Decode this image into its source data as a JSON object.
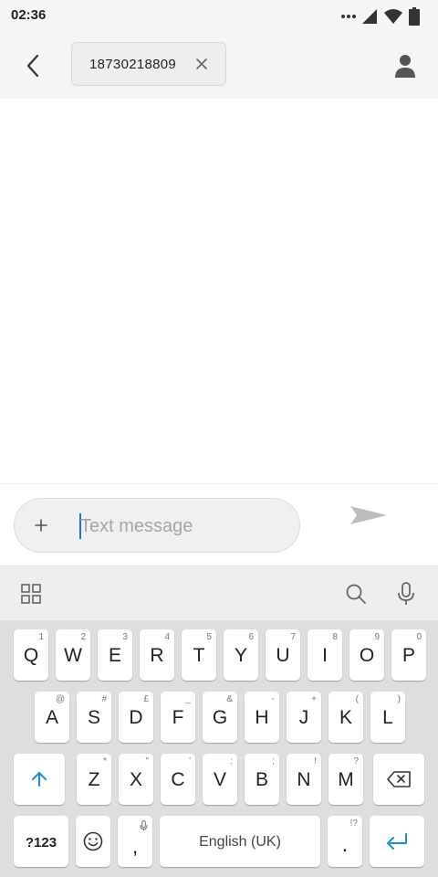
{
  "status_bar": {
    "time": "02:36",
    "icons": [
      "more-dots-icon",
      "signal-icon",
      "wifi-icon",
      "battery-icon"
    ]
  },
  "header": {
    "recipient": "18730218809",
    "icons": {
      "back": "chevron-left-icon",
      "remove": "close-icon",
      "contact": "person-icon"
    }
  },
  "compose": {
    "placeholder": "Text message",
    "value": "",
    "icons": {
      "attach": "plus-icon",
      "send": "send-icon"
    }
  },
  "keyboard_toolbar": {
    "icons": [
      "apps-grid-icon",
      "search-icon",
      "microphone-icon"
    ]
  },
  "keyboard": {
    "row1": [
      {
        "label": "Q",
        "hint": "1"
      },
      {
        "label": "W",
        "hint": "2"
      },
      {
        "label": "E",
        "hint": "3"
      },
      {
        "label": "R",
        "hint": "4"
      },
      {
        "label": "T",
        "hint": "5"
      },
      {
        "label": "Y",
        "hint": "6"
      },
      {
        "label": "U",
        "hint": "7"
      },
      {
        "label": "I",
        "hint": "8"
      },
      {
        "label": "O",
        "hint": "9"
      },
      {
        "label": "P",
        "hint": "0"
      }
    ],
    "row2": [
      {
        "label": "A",
        "hint": "@"
      },
      {
        "label": "S",
        "hint": "#"
      },
      {
        "label": "D",
        "hint": "£"
      },
      {
        "label": "F",
        "hint": "_"
      },
      {
        "label": "G",
        "hint": "&"
      },
      {
        "label": "H",
        "hint": "-"
      },
      {
        "label": "J",
        "hint": "+"
      },
      {
        "label": "K",
        "hint": "("
      },
      {
        "label": "L",
        "hint": ")"
      }
    ],
    "row3": [
      {
        "label": "Z",
        "hint": "*"
      },
      {
        "label": "X",
        "hint": "\""
      },
      {
        "label": "C",
        "hint": "'"
      },
      {
        "label": "V",
        "hint": ":"
      },
      {
        "label": "B",
        "hint": ";"
      },
      {
        "label": "N",
        "hint": "!"
      },
      {
        "label": "M",
        "hint": "?"
      }
    ],
    "symbols_label": "?123",
    "comma_label": ",",
    "space_label": "English (UK)",
    "period_label": ".",
    "period_hint": "!?",
    "accent_color": "#1a8fd8"
  }
}
